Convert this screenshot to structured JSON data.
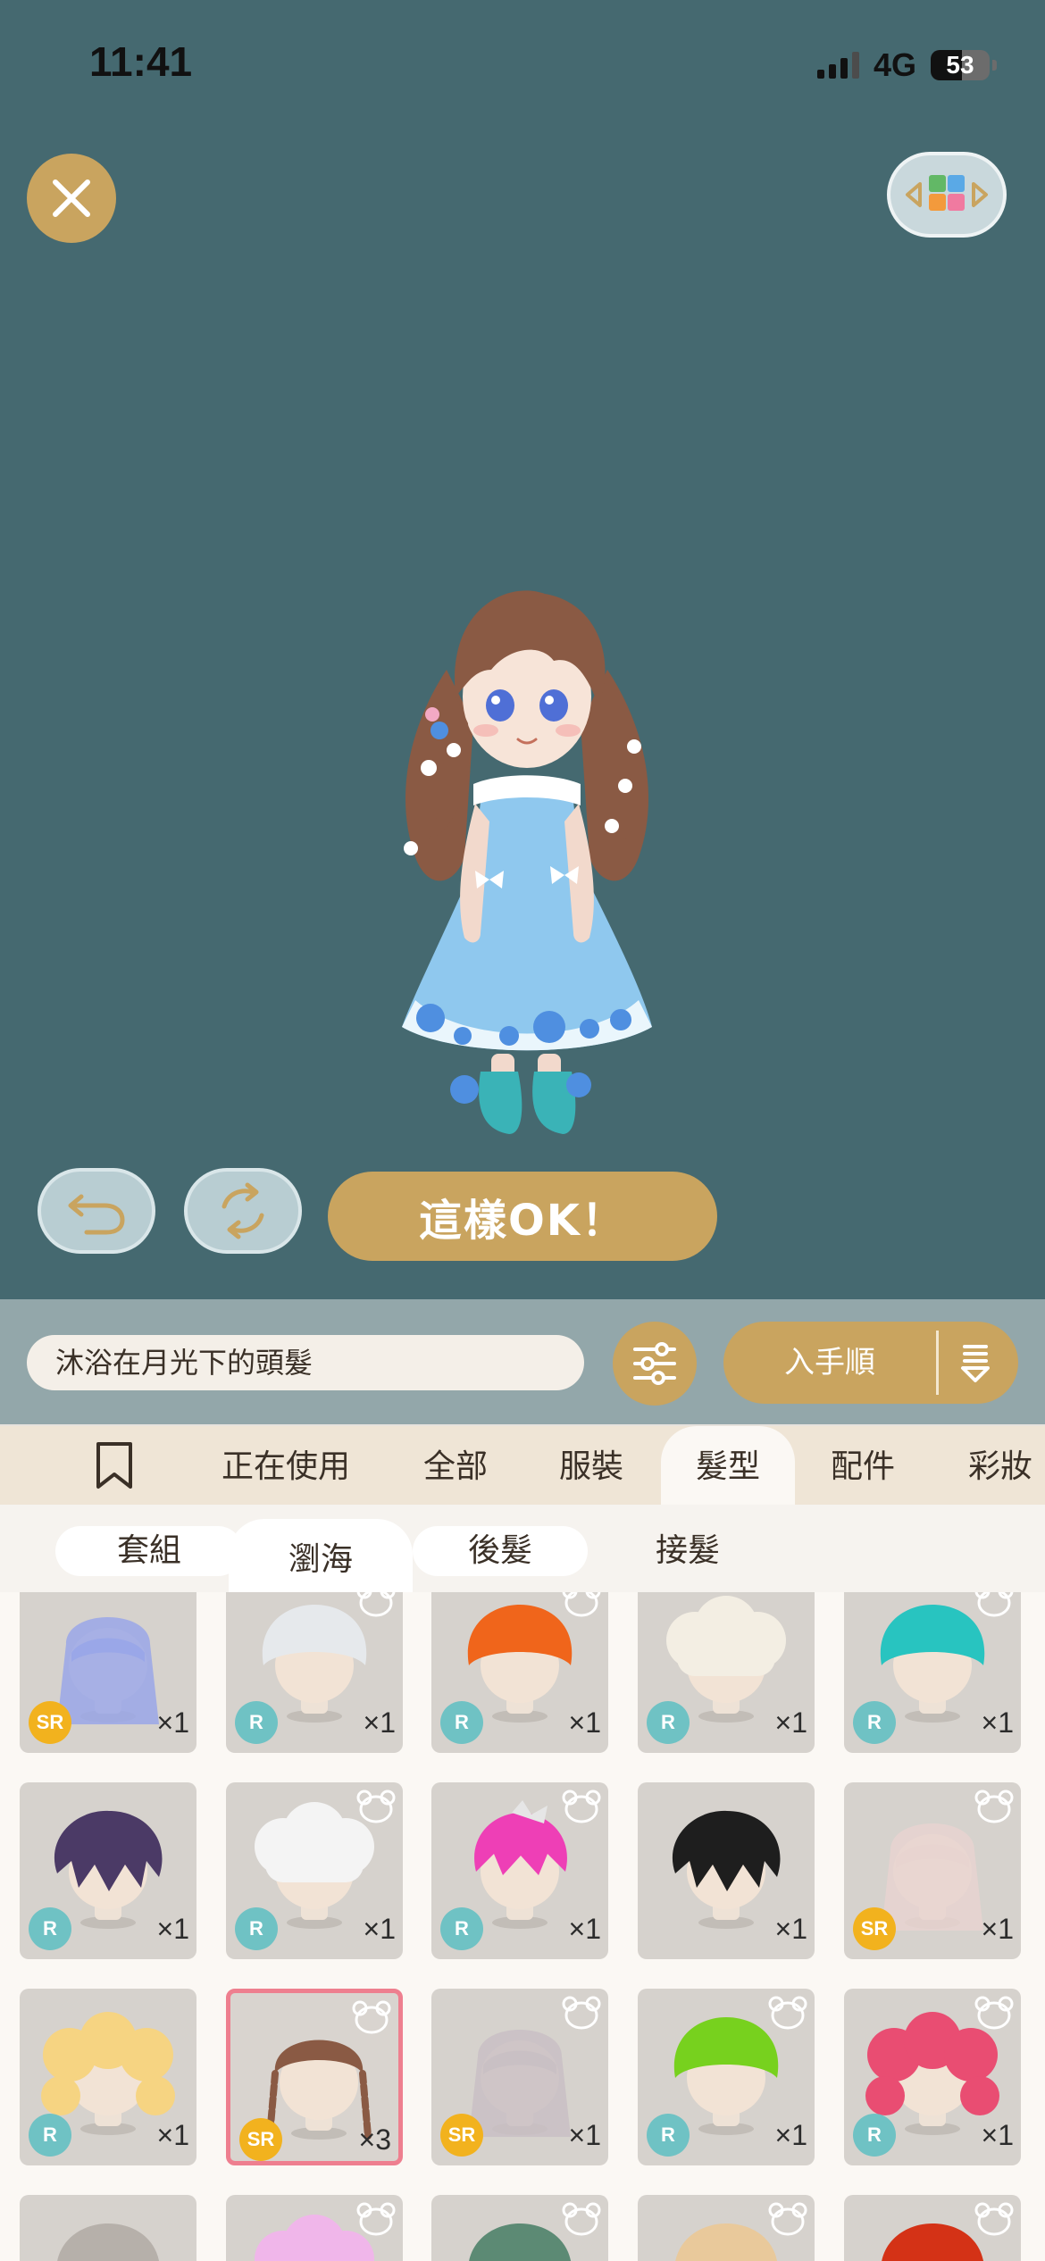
{
  "status_bar": {
    "time": "11:41",
    "network": "4G",
    "battery_level": "53",
    "battery_fill_percent": 53
  },
  "actions": {
    "confirm_label": "這樣OK！"
  },
  "filter": {
    "search_value": "沐浴在月光下的頭髮",
    "sort_label": "入手順"
  },
  "tabs": {
    "bookmark_icon": "bookmark-icon",
    "items": [
      "正在使用",
      "全部",
      "服裝",
      "髮型",
      "配件",
      "彩妝"
    ],
    "active": "髮型"
  },
  "subtabs": {
    "items": [
      "套組",
      "瀏海",
      "後髮",
      "接髮"
    ],
    "active": "瀏海"
  },
  "colors": {
    "accent_gold": "#c9a45f",
    "stage_bg": "#456970",
    "sr_badge": "#f2b21e",
    "r_badge": "#6fc2c4",
    "selected_border": "#ee7f8f"
  },
  "items": [
    {
      "rarity": "SR",
      "qty": "×1",
      "hair_color": "#9aa7e8",
      "style": "long"
    },
    {
      "rarity": "R",
      "qty": "×1",
      "hair_color": "#e6e9ec",
      "style": "short"
    },
    {
      "rarity": "R",
      "qty": "×1",
      "hair_color": "#f0651b",
      "style": "short"
    },
    {
      "rarity": "R",
      "qty": "×1",
      "hair_color": "#f3eee3",
      "style": "puff"
    },
    {
      "rarity": "R",
      "qty": "×1",
      "hair_color": "#28c4c0",
      "style": "short"
    },
    {
      "rarity": "R",
      "qty": "×1",
      "hair_color": "#4b3a66",
      "style": "messy"
    },
    {
      "rarity": "R",
      "qty": "×1",
      "hair_color": "#f4f4f4",
      "style": "puff"
    },
    {
      "rarity": "R",
      "qty": "×1",
      "hair_color": "#ee3fb6",
      "style": "spiky"
    },
    {
      "rarity": "",
      "qty": "×1",
      "hair_color": "#1e1e1e",
      "style": "messy"
    },
    {
      "rarity": "SR",
      "qty": "×1",
      "hair_color": "#e8d4d0",
      "style": "long"
    },
    {
      "rarity": "R",
      "qty": "×1",
      "hair_color": "#f6d482",
      "style": "curly"
    },
    {
      "rarity": "SR",
      "qty": "×3",
      "hair_color": "#8a5a44",
      "style": "braids",
      "selected": true
    },
    {
      "rarity": "SR",
      "qty": "×1",
      "hair_color": "#c9c0c4",
      "style": "long"
    },
    {
      "rarity": "R",
      "qty": "×1",
      "hair_color": "#77d11e",
      "style": "short"
    },
    {
      "rarity": "R",
      "qty": "×1",
      "hair_color": "#e94d72",
      "style": "curly"
    },
    {
      "rarity": "",
      "qty": "",
      "hair_color": "#b6b0aa",
      "style": "short"
    },
    {
      "rarity": "",
      "qty": "",
      "hair_color": "#f0b6ea",
      "style": "puff"
    },
    {
      "rarity": "",
      "qty": "",
      "hair_color": "#5c8a74",
      "style": "short"
    },
    {
      "rarity": "",
      "qty": "",
      "hair_color": "#e9c99b",
      "style": "short"
    },
    {
      "rarity": "",
      "qty": "",
      "hair_color": "#d43216",
      "style": "short"
    }
  ]
}
